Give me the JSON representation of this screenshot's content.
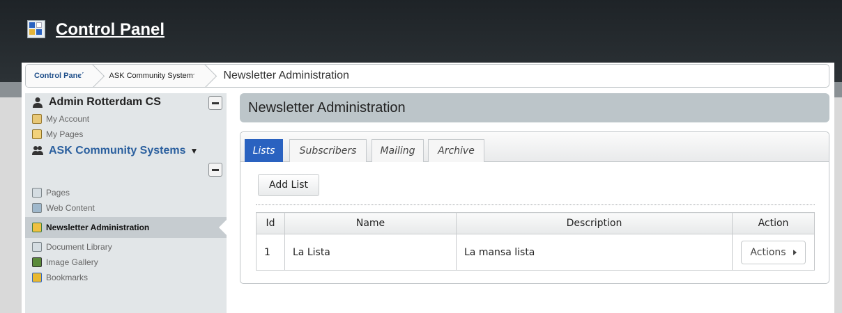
{
  "header": {
    "title": "Control Panel"
  },
  "breadcrumb": {
    "items": [
      "Control Panel",
      "ASK Community Systems"
    ],
    "current": "Newsletter Administration"
  },
  "sidebar": {
    "user_name": "Admin Rotterdam CS",
    "user_items": [
      "My Account",
      "My Pages"
    ],
    "site_name": "ASK Community Systems",
    "site_items": [
      "Pages",
      "Web Content",
      "Newsletter Administration",
      "Document Library",
      "Image Gallery",
      "Bookmarks"
    ]
  },
  "content": {
    "title": "Newsletter Administration",
    "tabs": [
      "Lists",
      "Subscribers",
      "Mailing",
      "Archive"
    ],
    "add_button": "Add List",
    "table": {
      "headers": [
        "Id",
        "Name",
        "Description",
        "Action"
      ],
      "rows": [
        {
          "id": "1",
          "name": "La Lista",
          "description": "La mansa lista",
          "action": "Actions"
        }
      ]
    }
  },
  "colors": {
    "accent": "#2a62c0",
    "topbar": "#23292d",
    "sidebar": "#e2e6e8"
  }
}
